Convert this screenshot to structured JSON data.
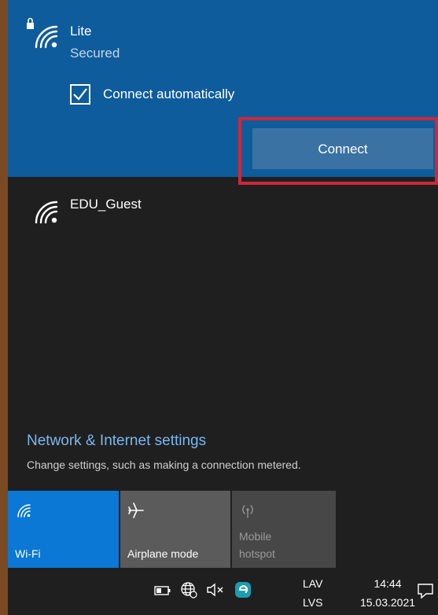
{
  "networks": [
    {
      "name": "Lite",
      "status": "Secured",
      "auto_label": "Connect automatically",
      "auto_checked": true,
      "connect_label": "Connect"
    },
    {
      "name": "EDU_Guest"
    }
  ],
  "settings": {
    "title": "Network & Internet settings",
    "subtitle": "Change settings, such as making a connection metered."
  },
  "quick_actions": [
    {
      "label": "Wi-Fi",
      "icon": "wifi-icon",
      "state": "on"
    },
    {
      "label": "Airplane mode",
      "icon": "airplane-icon",
      "state": "off"
    },
    {
      "label_line1": "Mobile",
      "label_line2": "hotspot",
      "icon": "hotspot-icon",
      "state": "disabled"
    }
  ],
  "taskbar": {
    "lang_top": "LAV",
    "lang_bottom": "LVS",
    "time": "14:44",
    "date": "15.03.2021",
    "icons": [
      "battery-icon",
      "network-globe-icon",
      "volume-muted-icon",
      "eset-icon",
      "notification-icon"
    ]
  },
  "colors": {
    "panel_bg": "#1f1f1f",
    "selected_bg": "#0f5c9c",
    "accent": "#0a78d4",
    "highlight_border": "#d0263a",
    "link": "#7ab8f0"
  }
}
